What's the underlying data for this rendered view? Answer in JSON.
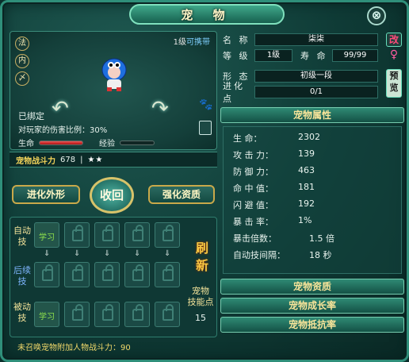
{
  "window": {
    "title": "宠 物",
    "close_label": "⊗"
  },
  "preview": {
    "side_buttons": [
      "法",
      "内",
      "〆"
    ],
    "level_text": "1级",
    "carry_text": "可携带",
    "bound_text": "已绑定",
    "damage_ratio_text": "对玩家的伤害比例：30%",
    "hp_label": "生命",
    "exp_label": "经验",
    "hp_fill": 1.0,
    "exp_fill": 0.0
  },
  "power": {
    "label": "宠物战斗力",
    "value": "678",
    "sep": "|",
    "stars": "★★"
  },
  "buttons": {
    "enhance_look": "进化外形",
    "recall": "收回",
    "enhance_quality": "强化资质"
  },
  "skills": {
    "row_labels": [
      "自动\n技",
      "后续\n技",
      "被动\n技"
    ],
    "learn_label": "学习",
    "refresh_label": "刷新",
    "points_label": "宠物\n技能点",
    "points_value": "15"
  },
  "info": {
    "name_label": "名 称",
    "name_value": "柒柒",
    "level_label": "等 级",
    "level_value": "1级",
    "life_label": "寿 命",
    "life_value": "99/99",
    "form_label": "形 态",
    "form_value": "初级一段",
    "evo_label": "进化点",
    "evo_value": "0/1",
    "rename_btn": "改",
    "gender_icon": "♀",
    "preview_btn": "预\n览"
  },
  "attributes_title": "宠物属性",
  "attributes": [
    {
      "k": "生      命：",
      "v": "2302"
    },
    {
      "k": "攻 击 力：",
      "v": "139"
    },
    {
      "k": "防 御 力：",
      "v": "463"
    },
    {
      "k": "命 中 值：",
      "v": "181"
    },
    {
      "k": "闪 避 值：",
      "v": "192"
    },
    {
      "k": "暴 击 率：",
      "v": "1%"
    },
    {
      "k": "暴击倍数：",
      "v": "1.5 倍"
    },
    {
      "k": "自动技间隔：",
      "v": "18 秒"
    }
  ],
  "sections": [
    "宠物资质",
    "宠物成长率",
    "宠物抵抗率"
  ],
  "footer": "未召唤宠物附加人物战斗力：90",
  "colors": {
    "accent_gold": "#f2d35a",
    "hp_red": "#e55",
    "learn_green": "#8fe24c"
  }
}
